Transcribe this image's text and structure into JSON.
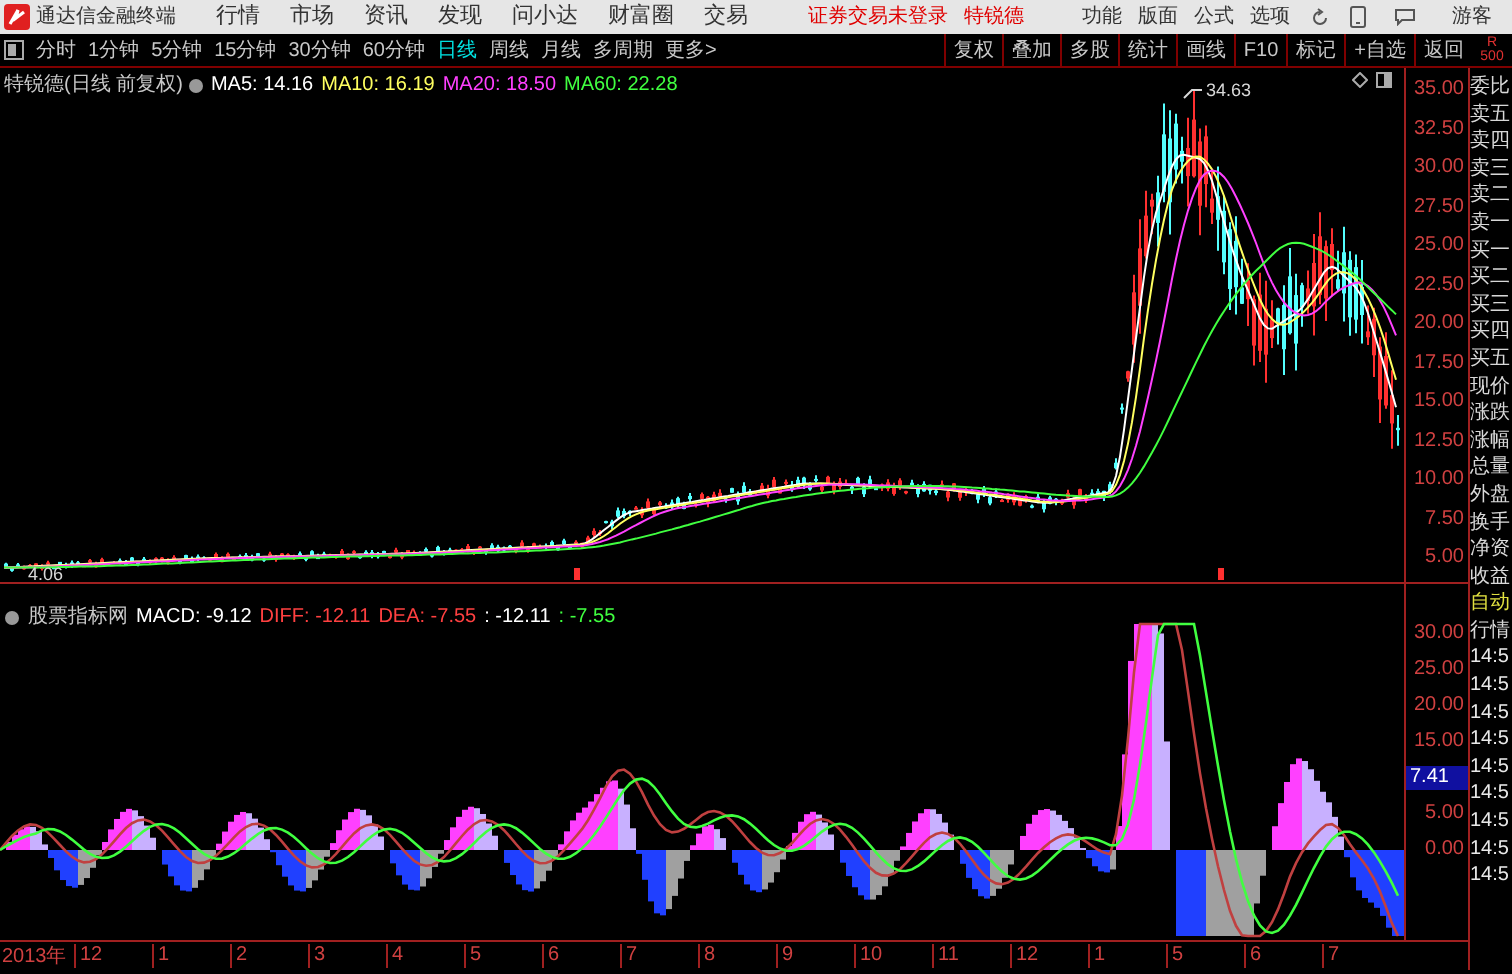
{
  "app": {
    "title": "通达信金融终端"
  },
  "menu": [
    "行情",
    "市场",
    "资讯",
    "发现",
    "问小达",
    "财富圈",
    "交易"
  ],
  "login_status": "证券交易未登录",
  "stock_name": "特锐德",
  "right_menu": [
    "功能",
    "版面",
    "公式",
    "选项"
  ],
  "user": "游客",
  "periods": [
    {
      "label": "分时",
      "selected": false
    },
    {
      "label": "1分钟",
      "selected": false
    },
    {
      "label": "5分钟",
      "selected": false
    },
    {
      "label": "15分钟",
      "selected": false
    },
    {
      "label": "30分钟",
      "selected": false
    },
    {
      "label": "60分钟",
      "selected": false
    },
    {
      "label": "日线",
      "selected": true
    },
    {
      "label": "周线",
      "selected": false
    },
    {
      "label": "月线",
      "selected": false
    },
    {
      "label": "多周期",
      "selected": false
    },
    {
      "label": "更多>",
      "selected": false
    }
  ],
  "tools": [
    "复权",
    "叠加",
    "多股",
    "统计",
    "画线",
    "F10",
    "标记",
    "+自选",
    "返回"
  ],
  "corner": [
    "R",
    "500"
  ],
  "price_chart": {
    "title": "特锐德(日线 前复权)",
    "ma": [
      {
        "label": "MA5: 14.16",
        "color": "#ffffff"
      },
      {
        "label": "MA10: 16.19",
        "color": "#ffff60"
      },
      {
        "label": "MA20: 18.50",
        "color": "#ff40ff"
      },
      {
        "label": "MA60: 22.28",
        "color": "#40ff40"
      }
    ],
    "high_label": "34.63",
    "low_label": "4.06",
    "axis": [
      "35.00",
      "32.50",
      "30.00",
      "27.50",
      "25.00",
      "22.50",
      "20.00",
      "17.50",
      "15.00",
      "12.50",
      "10.00",
      "7.50",
      "5.00"
    ]
  },
  "indicator": {
    "name": "股票指标网",
    "values": [
      {
        "label": "MACD: -9.12",
        "color": "#ffffff"
      },
      {
        "label": "DIFF: -12.11",
        "color": "#ff4040"
      },
      {
        "label": "DEA: -7.55",
        "color": "#ff4040"
      },
      {
        "label": ": -12.11",
        "color": "#ffffff"
      },
      {
        "label": ": -7.55",
        "color": "#40ff40"
      }
    ],
    "axis": [
      {
        "label": "30.00",
        "kind": "tick"
      },
      {
        "label": "25.00",
        "kind": "tick"
      },
      {
        "label": "20.00",
        "kind": "tick"
      },
      {
        "label": "15.00",
        "kind": "tick"
      },
      {
        "label": "7.41",
        "kind": "current"
      },
      {
        "label": "5.00",
        "kind": "tick"
      },
      {
        "label": "0.00",
        "kind": "tick"
      }
    ]
  },
  "time_axis": [
    "2013年",
    "12",
    "1",
    "2",
    "3",
    "4",
    "5",
    "6",
    "7",
    "8",
    "9",
    "10",
    "11",
    "12",
    "1",
    "5",
    "6",
    "7"
  ],
  "quote_panel": [
    {
      "text": "委比",
      "kind": "label"
    },
    {
      "text": "卖五",
      "kind": "label"
    },
    {
      "text": "卖四",
      "kind": "label"
    },
    {
      "text": "卖三",
      "kind": "label"
    },
    {
      "text": "卖二",
      "kind": "label"
    },
    {
      "text": "卖一",
      "kind": "label"
    },
    {
      "text": "买一",
      "kind": "label"
    },
    {
      "text": "买二",
      "kind": "label"
    },
    {
      "text": "买三",
      "kind": "label"
    },
    {
      "text": "买四",
      "kind": "label"
    },
    {
      "text": "买五",
      "kind": "label"
    },
    {
      "text": "现价",
      "kind": "label"
    },
    {
      "text": "涨跌",
      "kind": "label"
    },
    {
      "text": "涨幅",
      "kind": "label"
    },
    {
      "text": "总量",
      "kind": "label"
    },
    {
      "text": "外盘",
      "kind": "label"
    },
    {
      "text": "换手",
      "kind": "label"
    },
    {
      "text": "净资",
      "kind": "label"
    },
    {
      "text": "收益",
      "kind": "label"
    },
    {
      "text": "自动",
      "kind": "mode"
    },
    {
      "text": "行情",
      "kind": "label"
    },
    {
      "text": "14:5",
      "kind": "time"
    },
    {
      "text": "14:5",
      "kind": "time"
    },
    {
      "text": "14:5",
      "kind": "time"
    },
    {
      "text": "14:5",
      "kind": "time"
    },
    {
      "text": "14:5",
      "kind": "time"
    },
    {
      "text": "14:5",
      "kind": "time"
    },
    {
      "text": "14:5",
      "kind": "time"
    },
    {
      "text": "14:5",
      "kind": "time"
    },
    {
      "text": "14:5",
      "kind": "time"
    }
  ]
}
